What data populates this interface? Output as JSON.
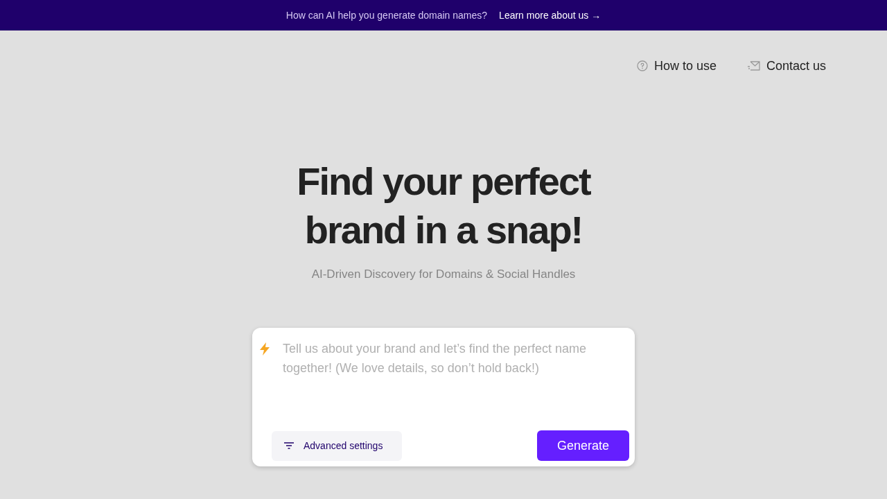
{
  "banner": {
    "text": "How can AI help you generate domain names?",
    "link": "Learn more about us →"
  },
  "nav": [
    {
      "label": "How to use",
      "kind": "help"
    },
    {
      "label": "Contact us",
      "kind": "contact"
    }
  ],
  "hero": {
    "title": "Find your perfect brand in a snap!",
    "subtitle": "AI-Driven Discovery for Domains & Social Handles"
  },
  "prompt": {
    "placeholder": "Tell us about your brand and let’s find the perfect name together! (We love details, so don’t hold back!)",
    "advanced_button": "Advanced settings",
    "submit_button": "Generate"
  }
}
